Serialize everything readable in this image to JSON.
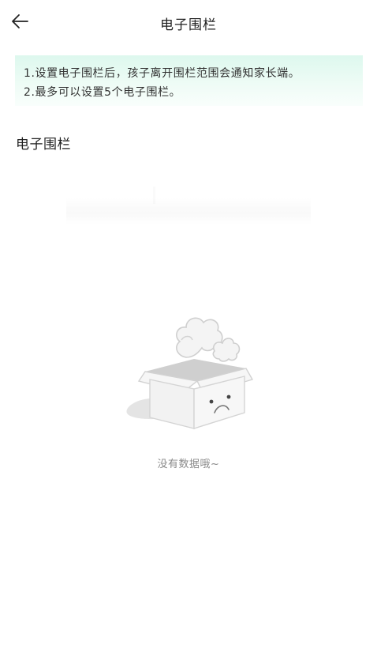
{
  "header": {
    "title": "电子围栏",
    "back_icon": "arrow-left-icon"
  },
  "notice": {
    "lines": [
      "1.设置电子围栏后，孩子离开围栏范围会通知家长端。",
      "2.最多可以设置5个电子围栏。"
    ],
    "background_color": "#e6faf2"
  },
  "section": {
    "title": "电子围栏"
  },
  "empty_state": {
    "icon": "empty-box-icon",
    "text": "没有数据哦~"
  }
}
